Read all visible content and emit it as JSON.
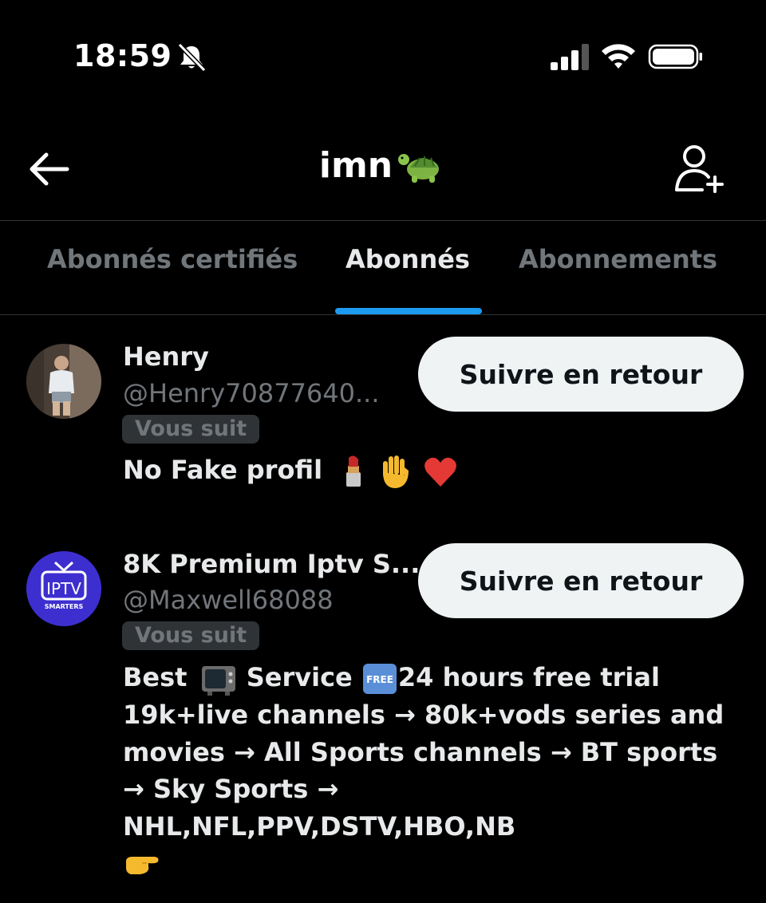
{
  "status_bar": {
    "time": "18:59",
    "icons": [
      "bell-slash-icon",
      "signal-icon",
      "wifi-icon",
      "battery-icon"
    ]
  },
  "header": {
    "title": "imn",
    "title_emoji": "turtle-emoji",
    "back_icon": "arrow-left-icon",
    "add_user_icon": "user-plus-icon"
  },
  "tabs": [
    {
      "label": "Abonnés certifiés",
      "active": false
    },
    {
      "label": "Abonnés",
      "active": true
    },
    {
      "label": "Abonnements",
      "active": false
    }
  ],
  "followers": [
    {
      "name": "Henry",
      "handle": "@Henry70877640...",
      "badge": "Vous suit",
      "button": "Suivre en retour",
      "bio_text": "No Fake profil",
      "bio_emojis": [
        "lipstick-emoji",
        "raised-hand-emoji",
        "red-heart-emoji"
      ]
    },
    {
      "name": "8K Premium Iptv S...",
      "handle": "@Maxwell68088",
      "badge": "Vous suit",
      "button": "Suivre en retour",
      "avatar_text": "IPTV",
      "avatar_subtext": "SMARTERS",
      "bio_lines": {
        "l1a": "Best",
        "l1b": "Service",
        "l1c": "24 hours free trial",
        "l2": "19k+live channels → 80k+vods series and",
        "l3": "movies → All Sports channels → BT sports",
        "l4": "→ Sky Sports →",
        "l5": "NHL,NFL,PPV,DSTV,HBO,NB"
      },
      "free_label": "FREE",
      "bio_emojis": [
        "television-emoji",
        "free-button-emoji",
        "pointing-right-emoji"
      ]
    }
  ],
  "colors": {
    "background": "#000000",
    "text_primary": "#e7e9ea",
    "text_secondary": "#71767b",
    "accent": "#1d9bf0",
    "button_bg": "#eff3f4"
  }
}
